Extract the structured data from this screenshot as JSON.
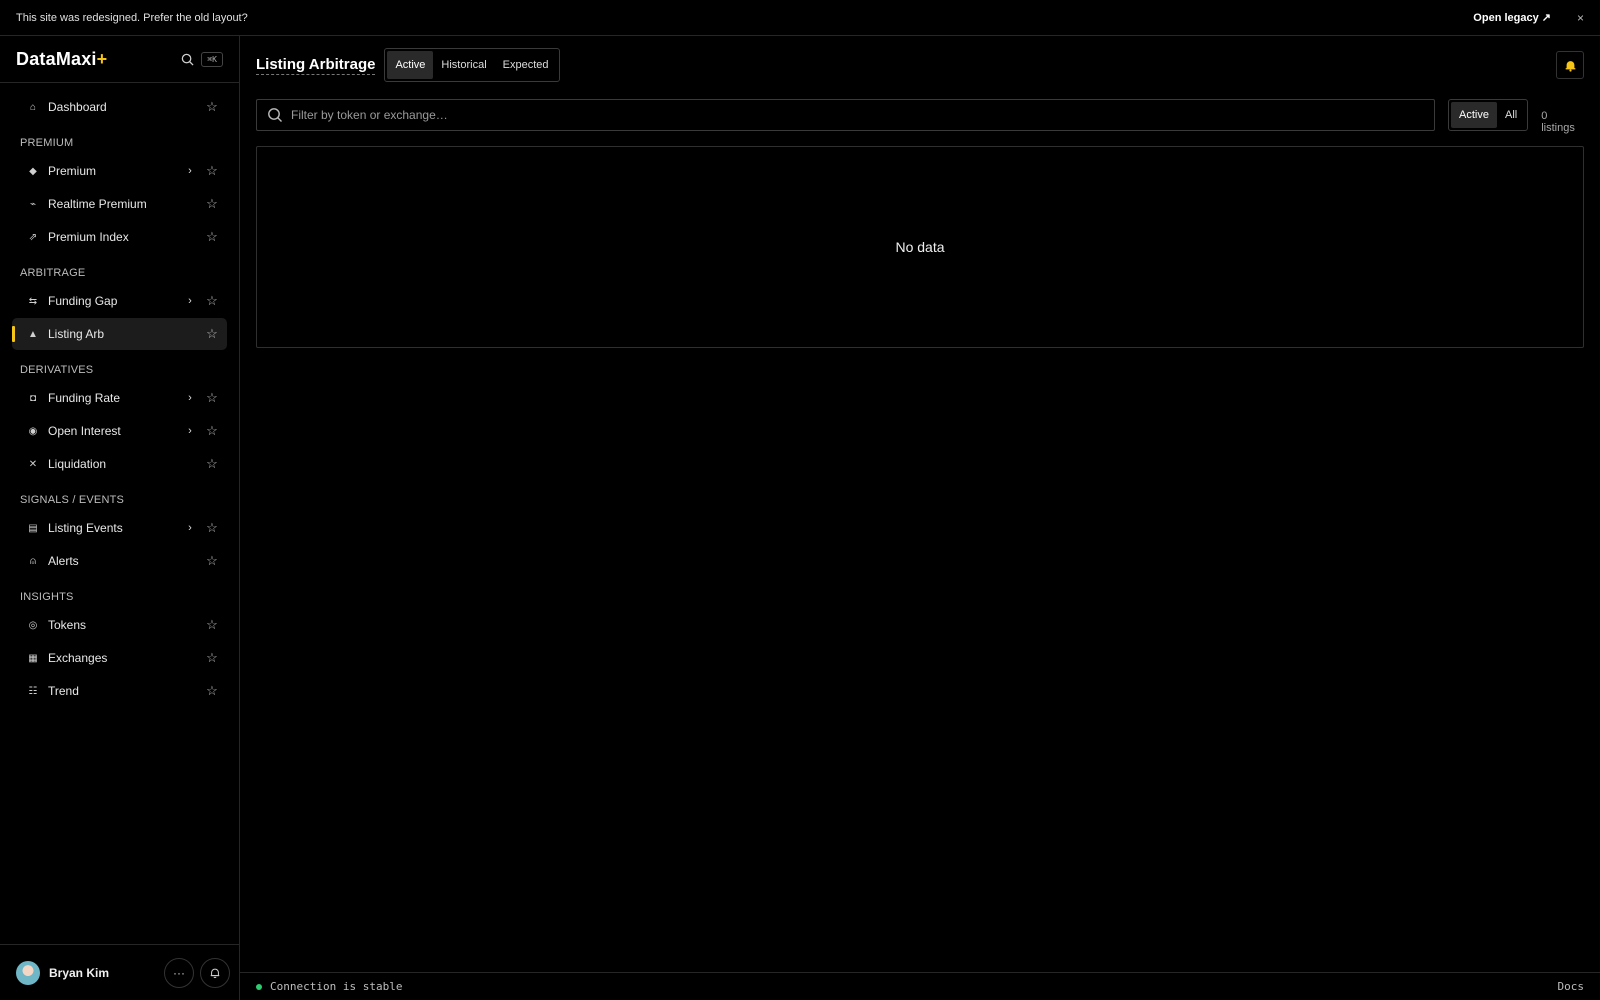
{
  "banner": {
    "message": "This site was redesigned. Prefer the old layout?",
    "legacy_link": "Open legacy ↗",
    "close_glyph": "×"
  },
  "sidebar": {
    "brand": "DataMaxi",
    "brand_plus": "+",
    "shortcut": "⌘K",
    "dashboard": {
      "label": "Dashboard",
      "icon": "home-icon",
      "glyph": "⌂"
    },
    "sections": [
      {
        "title": "PREMIUM",
        "items": [
          {
            "label": "Premium",
            "glyph": "◆",
            "chevron": "›"
          },
          {
            "label": "Realtime Premium",
            "glyph": "⌁"
          },
          {
            "label": "Premium Index",
            "glyph": "⇗"
          }
        ]
      },
      {
        "title": "ARBITRAGE",
        "items": [
          {
            "label": "Funding Gap",
            "glyph": "⇆",
            "chevron": "›"
          },
          {
            "label": "Listing Arb",
            "glyph": "▲"
          }
        ]
      },
      {
        "title": "DERIVATIVES",
        "items": [
          {
            "label": "Funding Rate",
            "glyph": "◘",
            "chevron": "›"
          },
          {
            "label": "Open Interest",
            "glyph": "◉",
            "chevron": "›"
          },
          {
            "label": "Liquidation",
            "glyph": "✕"
          }
        ]
      },
      {
        "title": "SIGNALS / EVENTS",
        "items": [
          {
            "label": "Listing Events",
            "glyph": "▤",
            "chevron": "›"
          },
          {
            "label": "Alerts",
            "glyph": "⍝"
          }
        ]
      },
      {
        "title": "INSIGHTS",
        "items": [
          {
            "label": "Tokens",
            "glyph": "◎"
          },
          {
            "label": "Exchanges",
            "glyph": "▦"
          },
          {
            "label": "Trend",
            "glyph": "☷"
          }
        ]
      }
    ],
    "star_glyph": "☆",
    "active_item": "Listing Arb",
    "user_name": "Bryan Kim",
    "more_glyph": "···"
  },
  "main": {
    "title": "Listing Arbitrage",
    "tabs": [
      "Active",
      "Historical",
      "Expected"
    ],
    "selected_tab": "Active",
    "search_placeholder": "Filter by token or exchange…",
    "status_filter": [
      "Active",
      "All"
    ],
    "selected_status": "Active",
    "listing_count": "0 listings",
    "empty_text": "No data"
  },
  "footer": {
    "connection": "Connection is stable",
    "docs": "Docs"
  },
  "colors": {
    "accent": "#f5c518",
    "status_ok": "#2ecc71",
    "background": "#000000"
  }
}
